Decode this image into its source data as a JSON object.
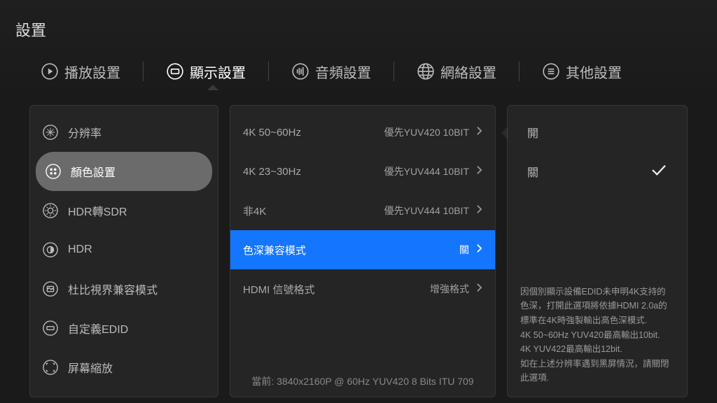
{
  "title": "設置",
  "tabs": [
    {
      "label": "播放設置"
    },
    {
      "label": "顯示設置"
    },
    {
      "label": "音頻設置"
    },
    {
      "label": "網絡設置"
    },
    {
      "label": "其他設置"
    }
  ],
  "sidebar": {
    "items": [
      {
        "label": "分辨率"
      },
      {
        "label": "顏色設置"
      },
      {
        "label": "HDR轉SDR"
      },
      {
        "label": "HDR"
      },
      {
        "label": "杜比視界兼容模式"
      },
      {
        "label": "自定義EDID"
      },
      {
        "label": "屏幕縮放"
      }
    ]
  },
  "midlist": {
    "rows": [
      {
        "label": "4K 50~60Hz",
        "value": "優先YUV420 10BIT"
      },
      {
        "label": "4K 23~30Hz",
        "value": "優先YUV444 10BIT"
      },
      {
        "label": "非4K",
        "value": "優先YUV444 10BIT"
      },
      {
        "label": "色深兼容模式",
        "value": "關"
      },
      {
        "label": "HDMI 信號格式",
        "value": "增強格式"
      }
    ],
    "status": "當前: 3840x2160P @ 60Hz  YUV420  8 Bits  ITU 709"
  },
  "options": {
    "items": [
      {
        "label": "開",
        "checked": false
      },
      {
        "label": "關",
        "checked": true
      }
    ]
  },
  "help_text": "因個別顯示設備EDID未申明4K支持的色深，打開此選項將依據HDMI 2.0a的標準在4K時強製輸出高色深模式.\n4K 50~60Hz YUV420最高輸出10bit.\n4K YUV422最高輸出12bit.\n如在上述分辨率遇到黑屏情況，請關閉此選項."
}
